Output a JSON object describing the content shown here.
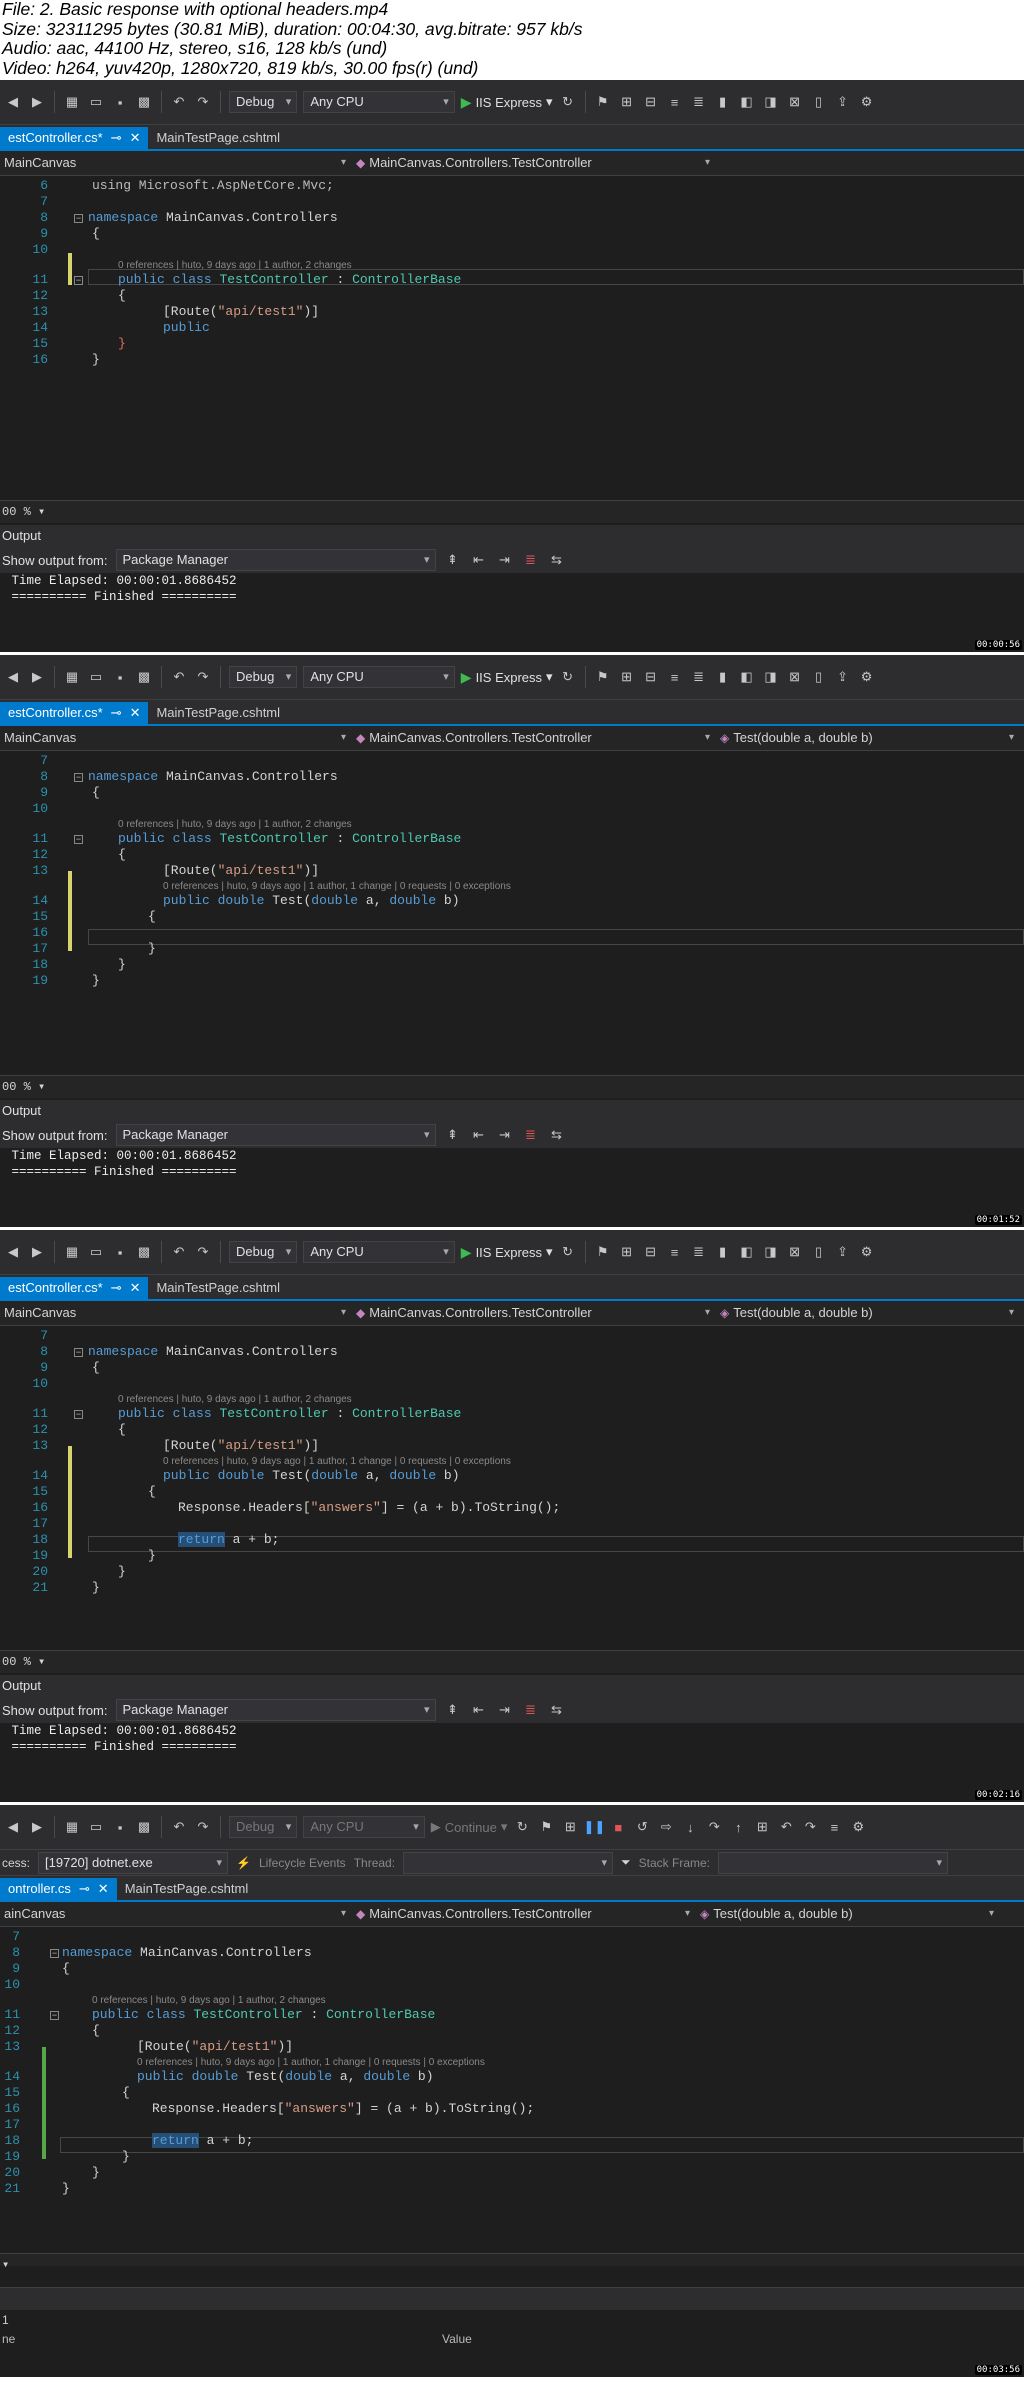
{
  "file_info": {
    "file": "File: 2. Basic response with optional headers.mp4",
    "size": "Size: 32311295 bytes (30.81 MiB), duration: 00:04:30, avg.bitrate: 957 kb/s",
    "audio": "Audio: aac, 44100 Hz, stereo, s16, 128 kb/s (und)",
    "video": "Video: h264, yuv420p, 1280x720, 819 kb/s, 30.00 fps(r) (und)"
  },
  "toolbar": {
    "config": "Debug",
    "platform": "Any CPU",
    "run_label": "IIS Express",
    "continue_label": "Continue"
  },
  "debug_bar": {
    "process_label": "cess:",
    "process_value": "[19720] dotnet.exe",
    "lifecycle": "Lifecycle Events",
    "thread": "Thread:",
    "stack": "Stack Frame:"
  },
  "tabs": {
    "tab1": "estController.cs*",
    "tab1_alt": "ontroller.cs",
    "tab2": "MainTestPage.cshtml"
  },
  "nav": {
    "project": "MainCanvas",
    "project_alt": "ainCanvas",
    "class": "MainCanvas.Controllers.TestController",
    "method": "Test(double a, double b)"
  },
  "code": {
    "ns_kw": "namespace",
    "ns_name": " MainCanvas.Controllers",
    "using_line": "using Microsoft.AspNetCore.Mvc;",
    "brace_open": "{",
    "brace_close": "}",
    "lens_class": "0 references | huto, 9 days ago | 1 author, 2 changes",
    "lens_method": "0 references | huto, 9 days ago | 1 author, 1 change | 0 requests | 0 exceptions",
    "public_kw": "public",
    "class_kw": "class",
    "class_name": "TestController",
    "colon": " : ",
    "base_name": "ControllerBase",
    "route_open": "[Route(",
    "route_str": "\"api/test1\"",
    "route_close": ")]",
    "double_kw": "double",
    "method_name": "Test",
    "params_open": "(",
    "param_a": " a, ",
    "param_b": " b)",
    "headers_stmt": "Response.Headers[",
    "headers_key": "\"answers\"",
    "headers_rest": "] = (a + b).ToString();",
    "return_kw": "return",
    "return_rest": " a + b;"
  },
  "frames": [
    {
      "lines": [
        "6",
        "7",
        "8",
        "9",
        "10",
        "11",
        "12",
        "13",
        "14",
        "15",
        "16"
      ],
      "zoom": "00 %",
      "time": "00:00:56"
    },
    {
      "lines": [
        "7",
        "8",
        "9",
        "10",
        "11",
        "12",
        "13",
        "14",
        "15",
        "16",
        "17",
        "18",
        "19"
      ],
      "zoom": "00 %",
      "time": "00:01:52"
    },
    {
      "lines": [
        "7",
        "8",
        "9",
        "10",
        "11",
        "12",
        "13",
        "14",
        "15",
        "16",
        "17",
        "18",
        "19",
        "20",
        "21"
      ],
      "zoom": "00 %",
      "time": "00:02:16"
    },
    {
      "lines": [
        "7",
        "8",
        "9",
        "10",
        "11",
        "12",
        "13",
        "14",
        "15",
        "16",
        "17",
        "18",
        "19",
        "20",
        "21"
      ],
      "zoom": "",
      "time": "00:03:56"
    }
  ],
  "output": {
    "title": "Output",
    "show_from": "Show output from:",
    "source": "Package Manager",
    "line1": " Time Elapsed: 00:00:01.8686452",
    "line2": " ========== Finished =========="
  },
  "watch": {
    "name_col": "ne",
    "value_col": "Value",
    "mark": "1"
  }
}
